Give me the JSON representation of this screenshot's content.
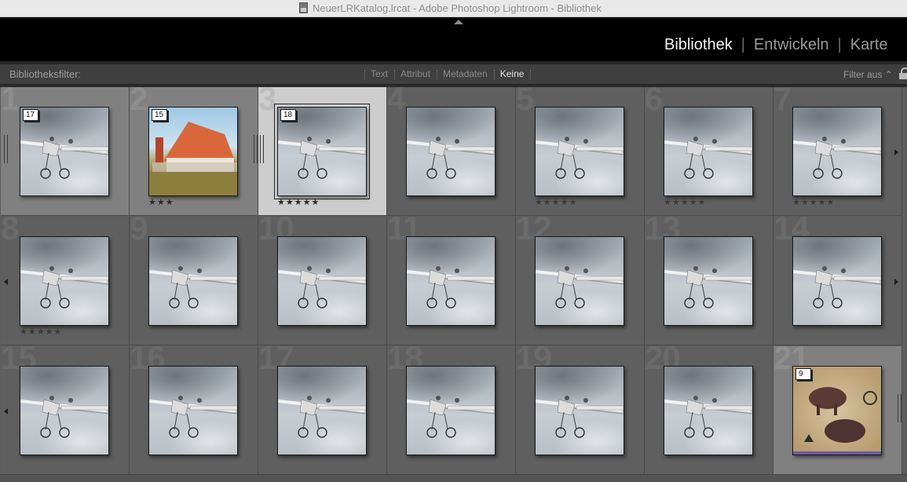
{
  "window": {
    "title": "NeuerLRKatalog.lrcat - Adobe Photoshop Lightroom - Bibliothek"
  },
  "modules": {
    "items": [
      "Bibliothek",
      "Entwickeln",
      "Karte"
    ],
    "active": "Bibliothek"
  },
  "filterbar": {
    "label": "Bibliotheksfilter:",
    "options": [
      "Text",
      "Attribut",
      "Metadaten",
      "Keine"
    ],
    "selected": "Keine",
    "state": "Filter aus ⌃"
  },
  "grid": {
    "cells": [
      {
        "num": "1",
        "badge": "17",
        "stars": "",
        "image": "airplane",
        "selected": "secondary"
      },
      {
        "num": "2",
        "badge": "15",
        "stars": "★★★",
        "image": "house",
        "selected": "secondary"
      },
      {
        "num": "3",
        "badge": "18",
        "stars": "★★★★★",
        "image": "airplane",
        "selected": "active"
      },
      {
        "num": "4",
        "badge": "",
        "stars": "",
        "image": "airplane",
        "selected": "none"
      },
      {
        "num": "5",
        "badge": "",
        "stars": "★★★★★",
        "image": "airplane",
        "selected": "none"
      },
      {
        "num": "6",
        "badge": "",
        "stars": "★★★★★",
        "image": "airplane",
        "selected": "none"
      },
      {
        "num": "7",
        "badge": "",
        "stars": "★★★★★",
        "image": "airplane",
        "selected": "none"
      },
      {
        "num": "8",
        "badge": "",
        "stars": "★★★★★",
        "image": "airplane",
        "selected": "none"
      },
      {
        "num": "9",
        "badge": "",
        "stars": "",
        "image": "airplane",
        "selected": "none"
      },
      {
        "num": "10",
        "badge": "",
        "stars": "",
        "image": "airplane",
        "selected": "none"
      },
      {
        "num": "11",
        "badge": "",
        "stars": "",
        "image": "airplane",
        "selected": "none"
      },
      {
        "num": "12",
        "badge": "",
        "stars": "",
        "image": "airplane",
        "selected": "none"
      },
      {
        "num": "13",
        "badge": "",
        "stars": "",
        "image": "airplane",
        "selected": "none"
      },
      {
        "num": "14",
        "badge": "",
        "stars": "",
        "image": "airplane",
        "selected": "none"
      },
      {
        "num": "15",
        "badge": "",
        "stars": "",
        "image": "airplane",
        "selected": "none"
      },
      {
        "num": "16",
        "badge": "",
        "stars": "",
        "image": "airplane",
        "selected": "none"
      },
      {
        "num": "17",
        "badge": "",
        "stars": "",
        "image": "airplane",
        "selected": "none"
      },
      {
        "num": "18",
        "badge": "",
        "stars": "",
        "image": "airplane",
        "selected": "none"
      },
      {
        "num": "19",
        "badge": "",
        "stars": "",
        "image": "airplane",
        "selected": "none"
      },
      {
        "num": "20",
        "badge": "",
        "stars": "",
        "image": "airplane",
        "selected": "none"
      },
      {
        "num": "21",
        "badge": "9",
        "stars": "",
        "image": "bison",
        "selected": "secondary"
      }
    ]
  }
}
